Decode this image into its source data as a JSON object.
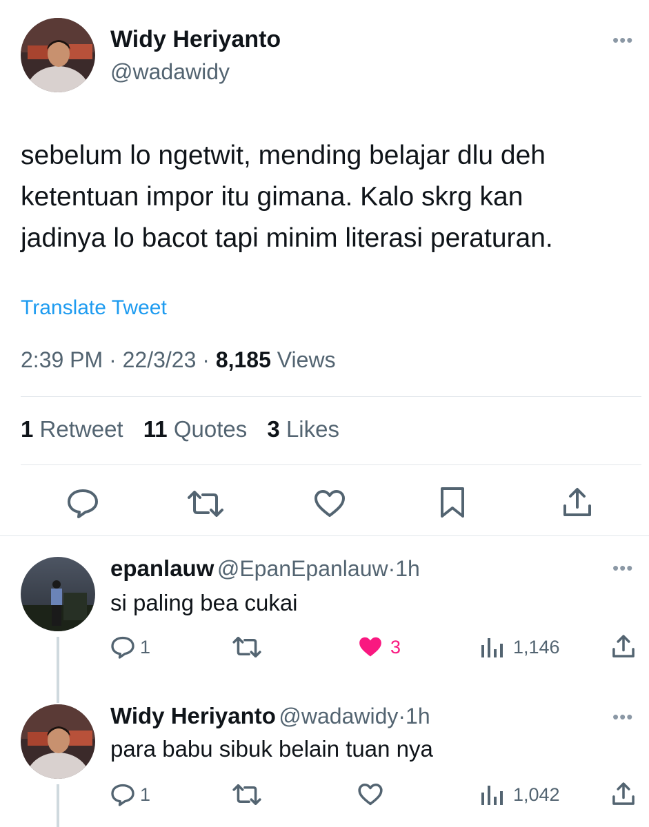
{
  "tweet": {
    "author_name": "Widy Heriyanto",
    "author_handle": "@wadawidy",
    "text_lines": [
      "sebelum lo ngetwit, mending belajar dlu deh",
      "ketentuan impor itu gimana. Kalo skrg kan",
      "jadinya lo bacot tapi minim literasi peraturan."
    ],
    "translate_label": "Translate Tweet",
    "time": "2:39 PM",
    "date": "22/3/23",
    "views_count": "8,185",
    "views_label": "Views",
    "sep": "·",
    "stats": {
      "retweets_count": "1",
      "retweets_label": "Retweet",
      "quotes_count": "11",
      "quotes_label": "Quotes",
      "likes_count": "3",
      "likes_label": "Likes"
    }
  },
  "replies": [
    {
      "name": "epanlauw",
      "handle": "@EpanEpanlauw",
      "time": "1h",
      "text": "si paling bea cukai",
      "reply_count": "1",
      "like_count": "3",
      "views": "1,146"
    },
    {
      "name": "Widy Heriyanto",
      "handle": "@wadawidy",
      "time": "1h",
      "text": "para babu sibuk belain tuan nya",
      "reply_count": "1",
      "views": "1,042"
    }
  ],
  "icons": {
    "more": "more-horizontal-icon",
    "reply": "reply-icon",
    "retweet": "retweet-icon",
    "like": "heart-icon",
    "bookmark": "bookmark-icon",
    "share": "share-icon",
    "views": "views-bar-chart-icon"
  },
  "colors": {
    "link": "#1d9bf0",
    "muted": "#536471",
    "liked": "#f91880",
    "text": "#0f1419"
  }
}
